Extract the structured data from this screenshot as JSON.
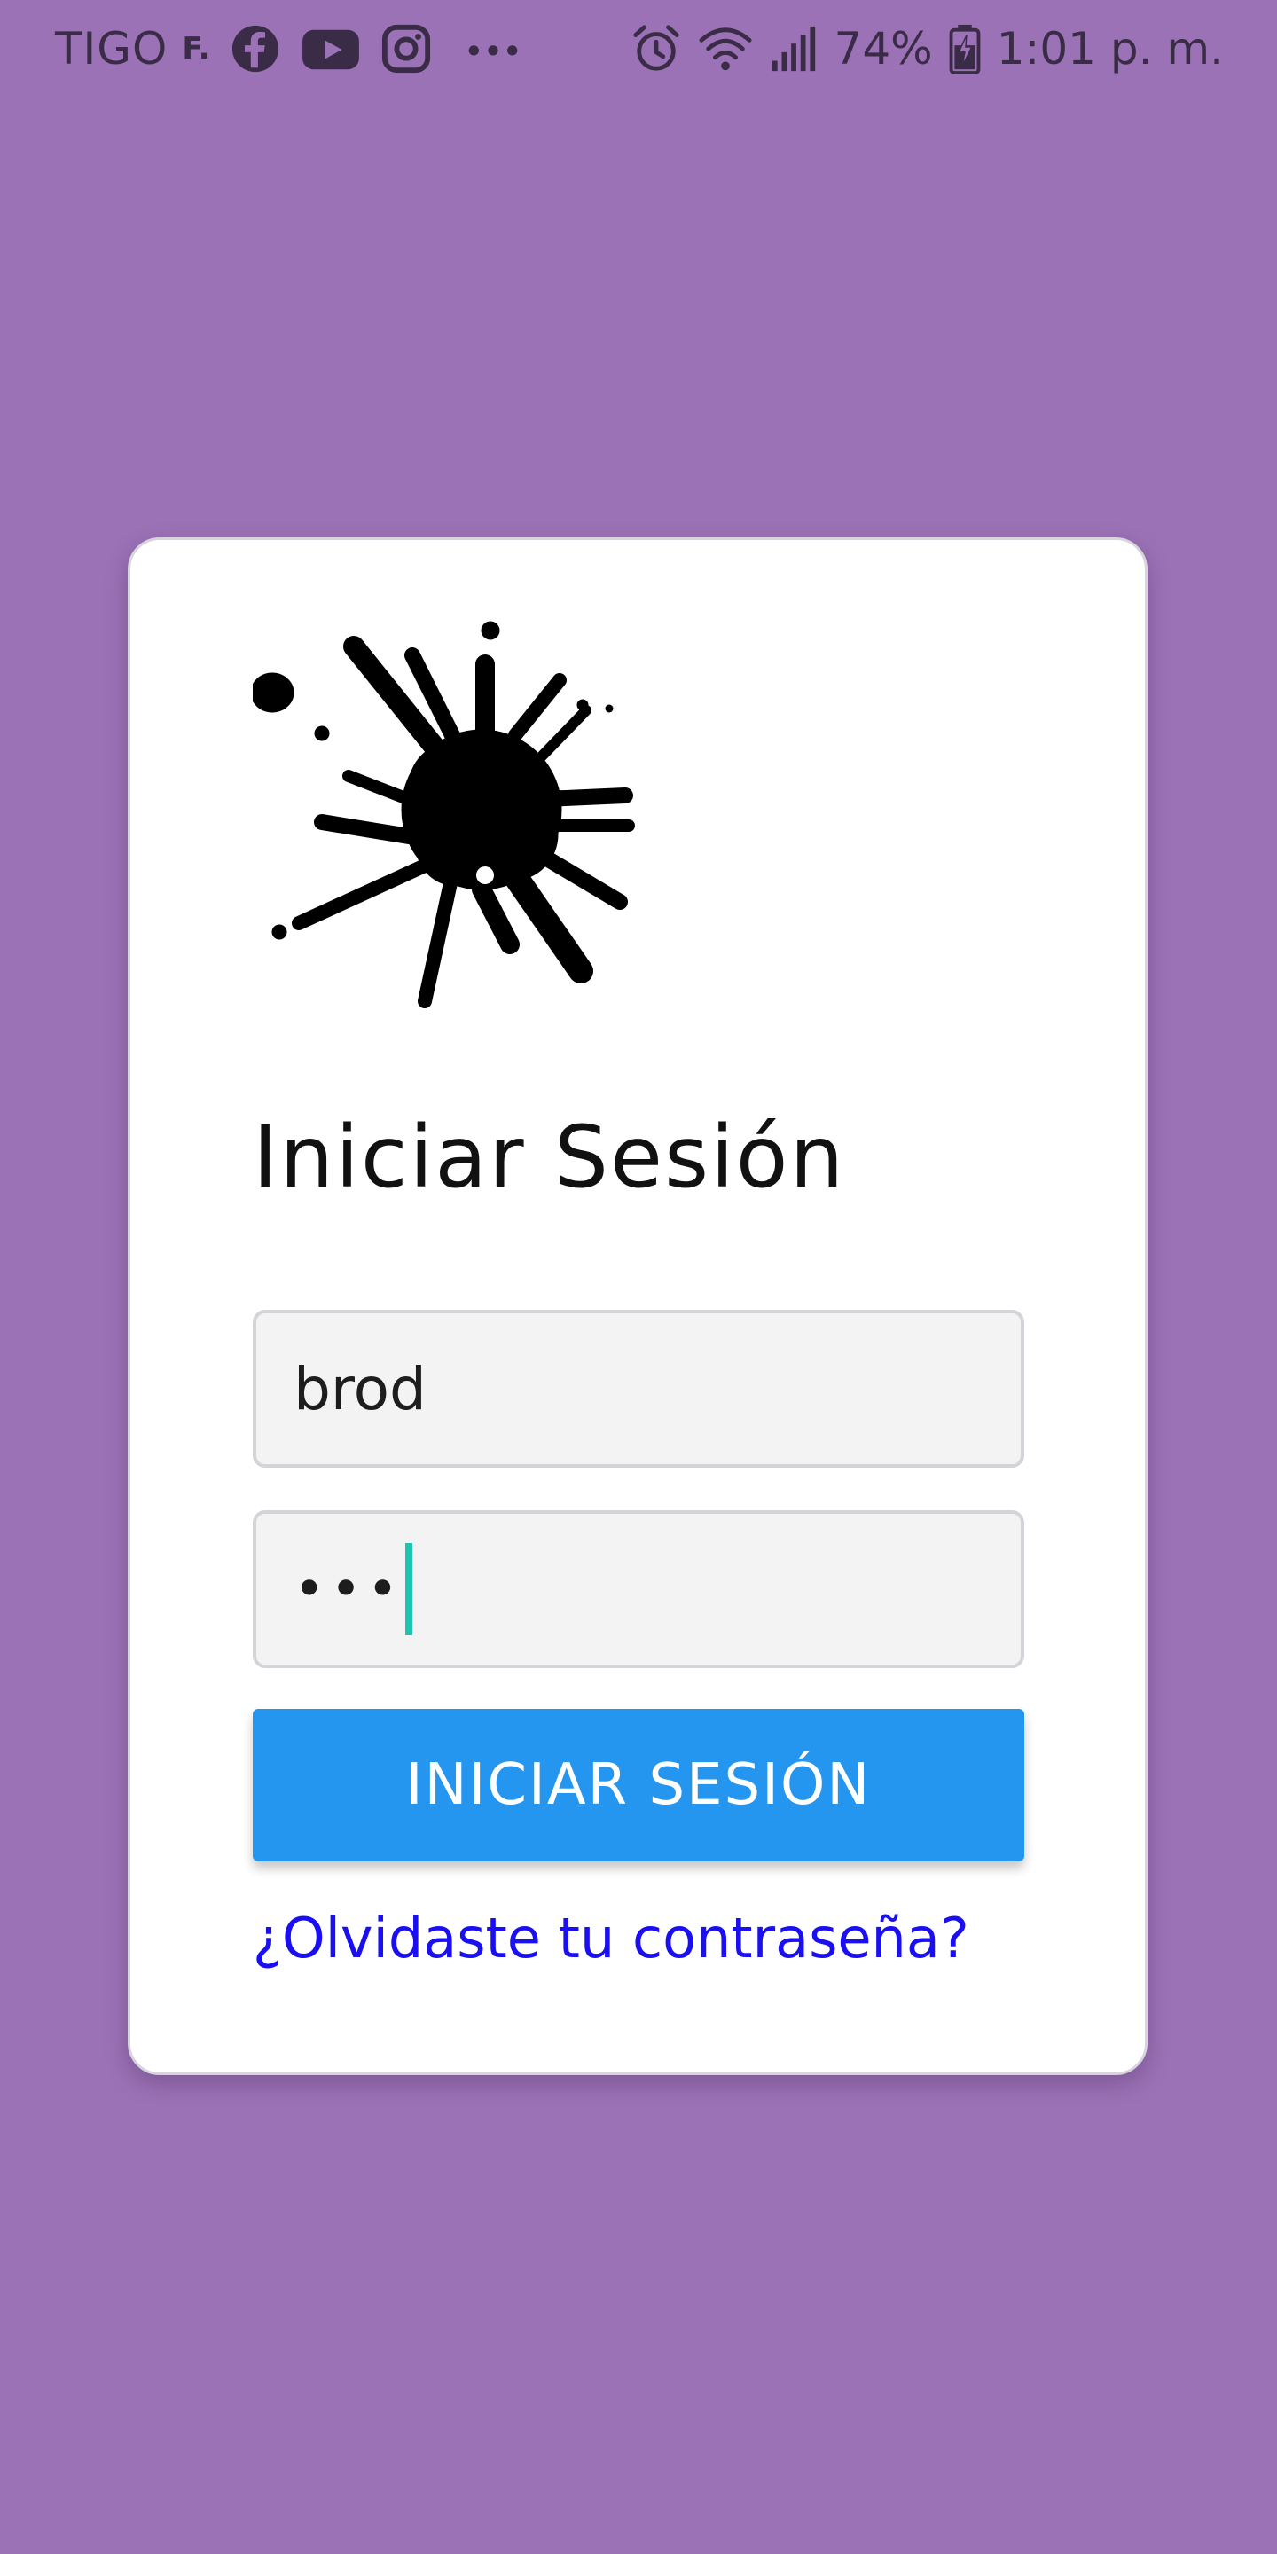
{
  "status_bar": {
    "carrier": "TIGO",
    "carrier_suffix": "F.",
    "notification_icons": [
      "facebook-icon",
      "youtube-icon",
      "instagram-icon",
      "more-dots-icon"
    ],
    "system_icons": [
      "alarm-icon",
      "wifi-icon",
      "signal-icon",
      "battery-icon"
    ],
    "battery_percent": "74%",
    "time": "1:01 p. m."
  },
  "login": {
    "title": "Iniciar Sesión",
    "username_value": "brod",
    "password_masked": "•••",
    "submit_label": "INICIAR SESIÓN",
    "forgot_password_label": "¿Olvidaste tu contraseña?"
  },
  "colors": {
    "background": "#9b72b6",
    "card": "#ffffff",
    "button": "#2596ef",
    "link": "#1a0ff0",
    "caret": "#1ec3b4"
  }
}
